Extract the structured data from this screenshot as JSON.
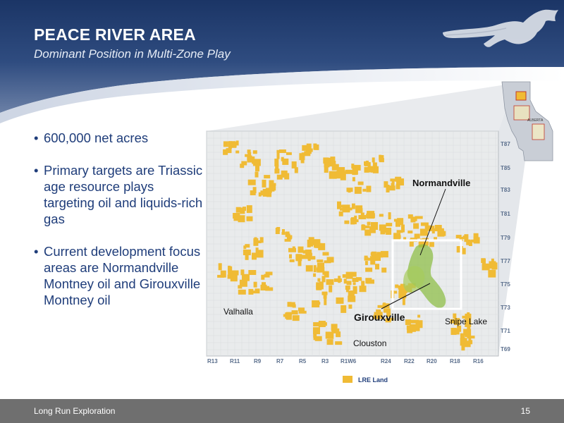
{
  "slide": {
    "title": "PEACE RIVER AREA",
    "subtitle": "Dominant Position in Multi-Zone Play"
  },
  "bullets": [
    "600,000 net acres",
    "Primary targets are Triassic age resource plays targeting oil and liquids-rich gas",
    "Current development focus areas are Normandville Montney oil and Girouxville Montney oil"
  ],
  "map": {
    "township_labels": [
      "T87",
      "T85",
      "T83",
      "T81",
      "T79",
      "T77",
      "T75",
      "T73",
      "T71",
      "T69"
    ],
    "range_labels": [
      "R13",
      "R11",
      "R9",
      "R7",
      "R5",
      "R3",
      "R1W6",
      "R24",
      "R22",
      "R20",
      "R18",
      "R16"
    ],
    "place_labels": {
      "normandville": "Normandville",
      "girouxville": "Girouxville",
      "valhalla": "Valhalla",
      "clouston": "Clouston",
      "snipe_lake": "Snipe Lake"
    },
    "inset_label": "ALBERTA",
    "legend_label": "LRE Land",
    "colors": {
      "land": "#f0bb35",
      "focus_area": "#8fbf4a",
      "map_background": "#e9ebec",
      "label_text": "#5a6e8c"
    }
  },
  "footer": {
    "company": "Long Run Exploration",
    "page_number": "15"
  }
}
